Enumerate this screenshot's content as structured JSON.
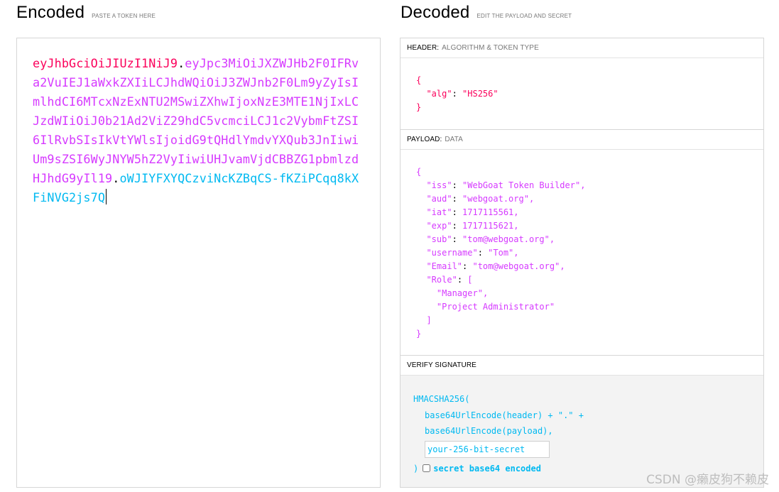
{
  "encoded": {
    "title": "Encoded",
    "subtitle": "PASTE A TOKEN HERE",
    "token_header": "eyJhbGciOiJIUzI1NiJ9",
    "token_payload": "eyJpc3MiOiJXZWJHb2F0IFRva2VuIEJ1aWxkZXIiLCJhdWQiOiJ3ZWJnb2F0Lm9yZyIsImlhdCI6MTcxNzExNTU2MSwiZXhwIjoxNzE3MTE1NjIxLCJzdWIiOiJ0b21Ad2ViZ29hdC5vcmciLCJ1c2VybmFtZSI6IlRvbSIsIkVtYWlsIjoidG9tQHdlYmdvYXQub3JnIiwiUm9sZSI6WyJNYW5hZ2VyIiwiUHJvamVjdCBBZG1pbmlzdHJhdG9yIl19",
    "token_signature": "oWJIYFXYQCzviNcKZBqCS-fKZiPCqq8kXFiNVG2js7Q",
    "dot": "."
  },
  "decoded": {
    "title": "Decoded",
    "subtitle": "EDIT THE PAYLOAD AND SECRET",
    "header_label": "HEADER:",
    "header_sub": "ALGORITHM & TOKEN TYPE",
    "payload_label": "PAYLOAD:",
    "payload_sub": "DATA",
    "verify_label": "VERIFY SIGNATURE",
    "header_json": {
      "alg": "HS256"
    },
    "payload_json": {
      "iss": "WebGoat Token Builder",
      "aud": "webgoat.org",
      "iat": 1717115561,
      "exp": 1717115621,
      "sub": "tom@webgoat.org",
      "username": "Tom",
      "Email": "tom@webgoat.org",
      "Role": [
        "Manager",
        "Project Administrator"
      ]
    },
    "verify": {
      "fn_open": "HMACSHA256(",
      "line1": "base64UrlEncode(header) + \".\" +",
      "line2": "base64UrlEncode(payload),",
      "secret_placeholder": "your-256-bit-secret",
      "close": ")",
      "checkbox_label": "secret base64 encoded"
    }
  },
  "watermark": "CSDN @癞皮狗不赖皮",
  "colors": {
    "header": "#fb015b",
    "payload": "#d63aff",
    "signature": "#00b9f1"
  }
}
